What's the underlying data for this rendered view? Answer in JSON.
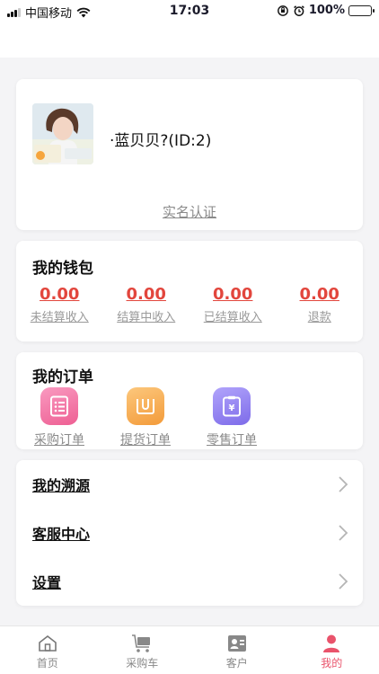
{
  "status_bar": {
    "carrier": "中国移动",
    "time": "17:03",
    "battery": "100%"
  },
  "profile": {
    "username": "·蓝贝贝?(ID:2)",
    "verify_link": "实名认证",
    "avatar_text": "蓝贝贝"
  },
  "wallet": {
    "title": "我的钱包",
    "items": [
      {
        "value": "0.00",
        "label": "未结算收入"
      },
      {
        "value": "0.00",
        "label": "结算中收入"
      },
      {
        "value": "0.00",
        "label": "已结算收入"
      },
      {
        "value": "0.00",
        "label": "退款"
      }
    ]
  },
  "orders": {
    "title": "我的订单",
    "items": [
      {
        "label": "采购订单",
        "icon": "purchase-order-icon",
        "color": "#f36fa0"
      },
      {
        "label": "提货订单",
        "icon": "pickup-order-icon",
        "color": "#f7a94a"
      },
      {
        "label": "零售订单",
        "icon": "retail-order-icon",
        "color": "#8b7cf0"
      }
    ]
  },
  "menu": {
    "items": [
      {
        "label": "我的溯源"
      },
      {
        "label": "客服中心"
      },
      {
        "label": "设置"
      }
    ]
  },
  "tabbar": {
    "items": [
      {
        "label": "首页",
        "icon": "home-icon"
      },
      {
        "label": "采购车",
        "icon": "cart-icon"
      },
      {
        "label": "客户",
        "icon": "contact-card-icon"
      },
      {
        "label": "我的",
        "icon": "user-icon"
      }
    ],
    "active": 3,
    "active_color": "#e9536b"
  }
}
